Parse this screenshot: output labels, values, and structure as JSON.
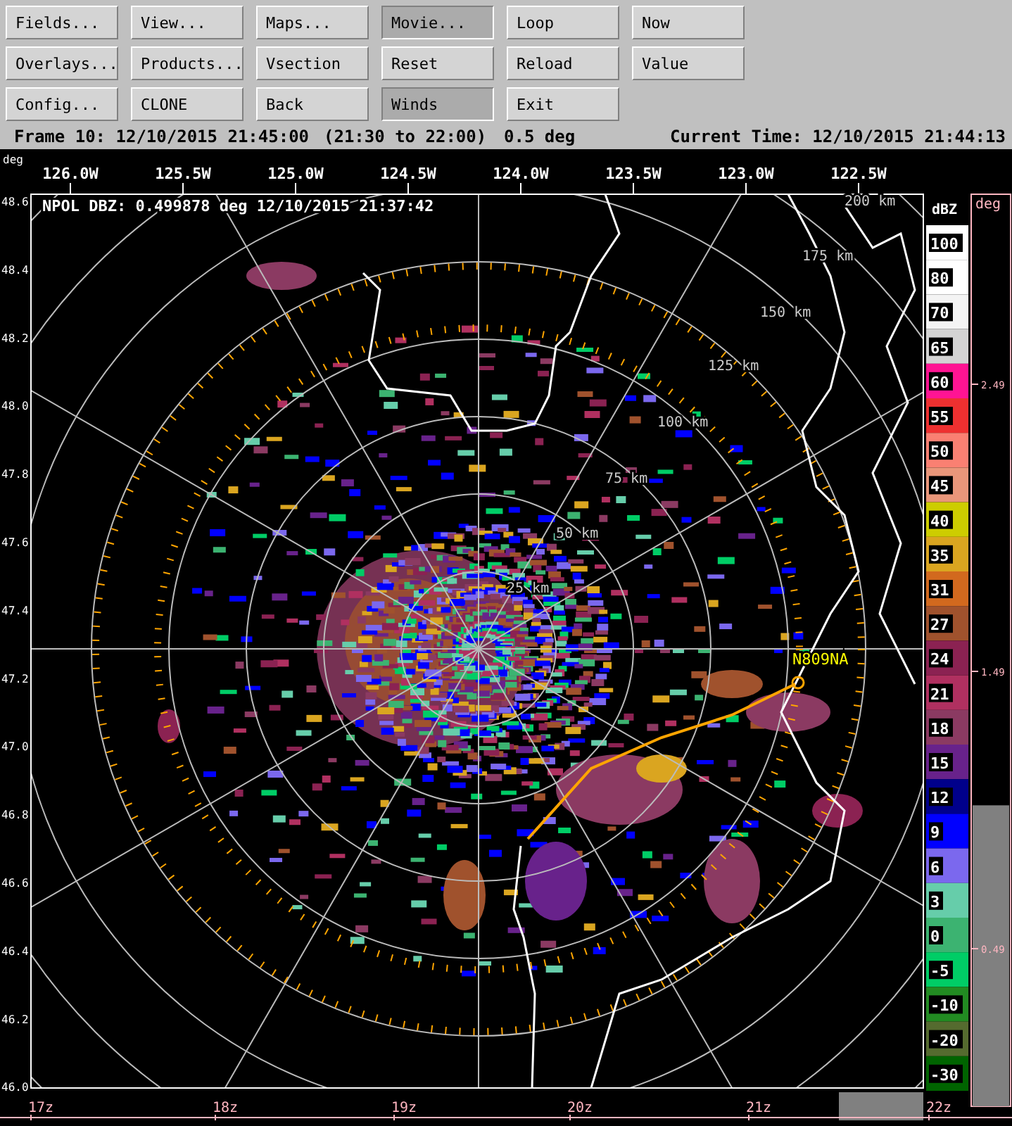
{
  "toolbar": {
    "rows": [
      [
        {
          "label": "Fields...",
          "selected": false
        },
        {
          "label": "View...",
          "selected": false
        },
        {
          "label": "Maps...",
          "selected": false
        },
        {
          "label": "Movie...",
          "selected": true
        },
        {
          "label": "Loop",
          "selected": false
        },
        {
          "label": "Now",
          "selected": false
        }
      ],
      [
        {
          "label": "Overlays...",
          "selected": false
        },
        {
          "label": "Products...",
          "selected": false
        },
        {
          "label": "Vsection",
          "selected": false
        },
        {
          "label": "Reset",
          "selected": false
        },
        {
          "label": "Reload",
          "selected": false
        },
        {
          "label": "Value",
          "selected": false
        }
      ],
      [
        {
          "label": "Config...",
          "selected": false
        },
        {
          "label": "CLONE",
          "selected": false
        },
        {
          "label": "Back",
          "selected": false
        },
        {
          "label": "Winds",
          "selected": true
        },
        {
          "label": "Exit",
          "selected": false
        }
      ]
    ]
  },
  "status_bar": {
    "frame": "Frame 10: 12/10/2015 21:45:00",
    "range": "(21:30 to 22:00)",
    "elevation": "0.5 deg",
    "current_time": "Current Time: 12/10/2015 21:44:13"
  },
  "plot": {
    "corner_unit": "deg",
    "title": "NPOL DBZ: 0.499878 deg 12/10/2015 21:37:42",
    "longitudes": [
      "126.0W",
      "125.5W",
      "125.0W",
      "124.5W",
      "124.0W",
      "123.5W",
      "123.0W",
      "122.5W"
    ],
    "latitudes": [
      "48.6",
      "48.4",
      "48.2",
      "48.0",
      "47.8",
      "47.6",
      "47.4",
      "47.2",
      "47.0",
      "46.8",
      "46.6",
      "46.4",
      "46.2",
      "46.0"
    ],
    "range_labels": [
      "200 km",
      "175 km",
      "150 km",
      "125 km",
      "100 km",
      "75 km",
      "50 km",
      "25 km"
    ],
    "aircraft_label": "N809NA"
  },
  "color_scale": {
    "unit": "dBZ",
    "entries": [
      {
        "label": "100",
        "color": "#ffffff"
      },
      {
        "label": "80",
        "color": "#ffffff"
      },
      {
        "label": "70",
        "color": "#f4f4f4"
      },
      {
        "label": "65",
        "color": "#d3d3d3"
      },
      {
        "label": "60",
        "color": "#ff1493"
      },
      {
        "label": "55",
        "color": "#ee3030"
      },
      {
        "label": "50",
        "color": "#fa8072"
      },
      {
        "label": "45",
        "color": "#e9967a"
      },
      {
        "label": "40",
        "color": "#cdcd00"
      },
      {
        "label": "35",
        "color": "#daa520"
      },
      {
        "label": "31",
        "color": "#d2691e"
      },
      {
        "label": "27",
        "color": "#a0522d"
      },
      {
        "label": "24",
        "color": "#8b2252"
      },
      {
        "label": "21",
        "color": "#b03060"
      },
      {
        "label": "18",
        "color": "#8b3a62"
      },
      {
        "label": "15",
        "color": "#68228b"
      },
      {
        "label": "12",
        "color": "#00008b"
      },
      {
        "label": "9",
        "color": "#0000ff"
      },
      {
        "label": "6",
        "color": "#7b68ee"
      },
      {
        "label": "3",
        "color": "#66cdaa"
      },
      {
        "label": "0",
        "color": "#3cb371"
      },
      {
        "label": "-5",
        "color": "#00cd66"
      },
      {
        "label": "-10",
        "color": "#228b22"
      },
      {
        "label": "-20",
        "color": "#556b2f"
      },
      {
        "label": "-30",
        "color": "#006400"
      }
    ]
  },
  "elevation_bar": {
    "unit": "deg",
    "ticks": [
      "2.49",
      "1.49",
      "0.49"
    ],
    "level": 0.33
  },
  "time_axis": {
    "labels": [
      "17z",
      "18z",
      "19z",
      "20z",
      "21z",
      "22z"
    ]
  }
}
